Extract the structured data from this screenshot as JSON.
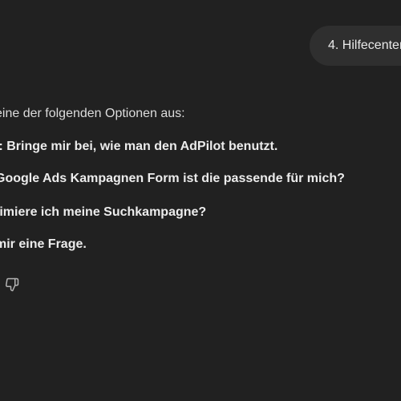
{
  "user_message": {
    "text": "4. Hilfecenter"
  },
  "assistant_message": {
    "intro": "eine der folgenden Optionen aus:",
    "options": [
      "l: Bringe mir bei, wie man den AdPilot benutzt.",
      "Google Ads Kampagnen Form ist die passende für mich?",
      "timiere ich meine Suchkampagne?",
      "mir eine Frage."
    ]
  },
  "actions": {
    "dislike_icon": "thumbs-down-icon"
  }
}
